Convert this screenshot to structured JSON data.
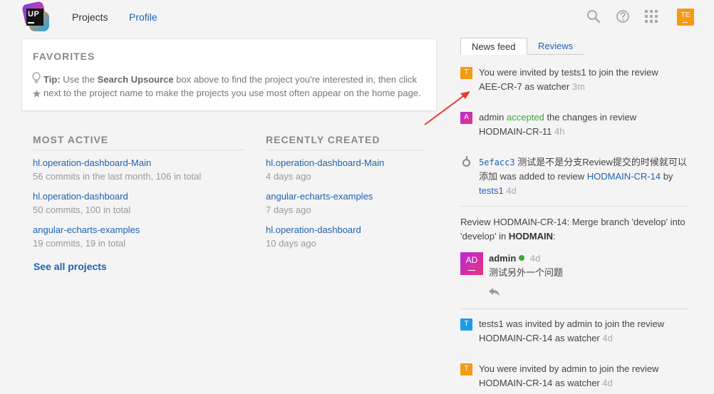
{
  "header": {
    "logo_text": "UP",
    "nav": [
      {
        "label": "Projects"
      },
      {
        "label": "Profile"
      }
    ],
    "user_initials": "TE"
  },
  "favorites": {
    "title": "FAVORITES",
    "tip_label": "Tip:",
    "line1_a": "Use the",
    "line1_b": "Search Upsource",
    "line1_c": "box above to find the project you're interested in, then click",
    "line2": "next to the project name to make the projects you use most often appear on the home page."
  },
  "most_active": {
    "title": "MOST ACTIVE",
    "items": [
      {
        "name": "hl.operation-dashboard-Main",
        "meta": "56 commits in the last month, 106 in total"
      },
      {
        "name": "hl.operation-dashboard",
        "meta": "50 commits, 100 in total"
      },
      {
        "name": "angular-echarts-examples",
        "meta": "19 commits, 19 in total"
      }
    ],
    "see_all": "See all projects"
  },
  "recently_created": {
    "title": "RECENTLY CREATED",
    "items": [
      {
        "name": "hl.operation-dashboard-Main",
        "meta": "4 days ago"
      },
      {
        "name": "angular-echarts-examples",
        "meta": "7 days ago"
      },
      {
        "name": "hl.operation-dashboard",
        "meta": "10 days ago"
      }
    ]
  },
  "tabs": [
    {
      "label": "News feed"
    },
    {
      "label": "Reviews"
    }
  ],
  "feed": {
    "f1": {
      "avatar": "T",
      "line1": "You were invited by tests1 to join the review",
      "line2": "AEE-CR-7 as watcher",
      "time": "3m"
    },
    "f2": {
      "avatar": "A",
      "user": "admin",
      "action": "accepted",
      "rest": "the changes in review",
      "review": "HODMAIN-CR-11",
      "time": "4h"
    },
    "f3": {
      "hash": "5efacc3",
      "msg": "测试是不是分支Review提交的时候就可以",
      "msg2": "添加",
      "was": "was added to review",
      "review": "HODMAIN-CR-14",
      "by": "by",
      "user": "tests1",
      "time": "4d"
    },
    "f4": {
      "line1": "Review HODMAIN-CR-14: Merge branch 'develop' into",
      "line2a": "'develop' in",
      "project": "HODMAIN",
      "colon": ":",
      "avatar": "AD",
      "user": "admin",
      "time": "4d",
      "comment": "测试另外一个问题"
    },
    "f5": {
      "avatar": "T",
      "line1": "tests1 was invited by admin to join the review",
      "line2": "HODMAIN-CR-14 as watcher",
      "time": "4d"
    },
    "f6": {
      "avatar": "T",
      "line1": "You were invited by admin to join the review",
      "line2": "HODMAIN-CR-14 as watcher",
      "time": "4d"
    }
  },
  "colors": {
    "accent": "#1f62b3",
    "orange_avatar": "#f59a12",
    "green": "#3ca83c",
    "red_arrow": "#e53935"
  }
}
